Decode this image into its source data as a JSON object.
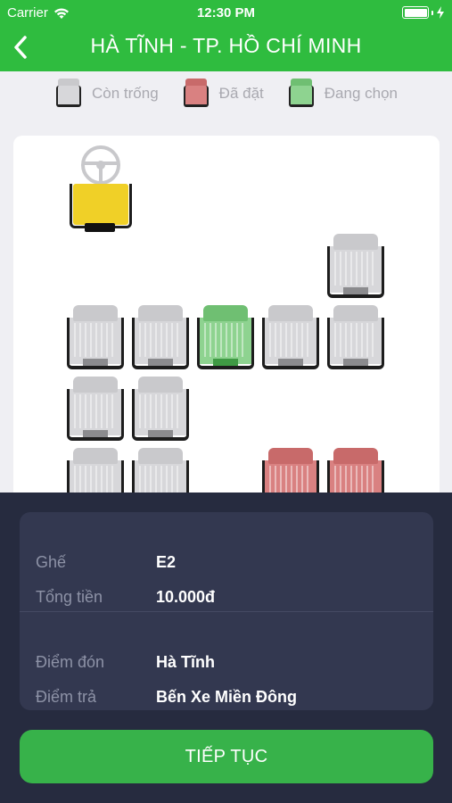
{
  "status_bar": {
    "carrier": "Carrier",
    "time": "12:30 PM"
  },
  "nav": {
    "title": "HÀ TĨNH - TP. HỒ CHÍ MINH",
    "back_icon": "chevron-left-icon"
  },
  "legend": {
    "available": "Còn trống",
    "booked": "Đã đặt",
    "selected": "Đang chọn"
  },
  "colors": {
    "brand_green": "#2fbc3f",
    "available": "#d7d7da",
    "booked": "#d98181",
    "selected": "#8ed390",
    "driver": "#f0d027",
    "sheet_bg": "#262b3f"
  },
  "seats": [
    {
      "state": "empty"
    },
    {
      "state": "empty"
    },
    {
      "state": "empty"
    },
    {
      "state": "selected"
    },
    {
      "state": "empty"
    },
    {
      "state": "empty"
    },
    {
      "state": "empty"
    },
    {
      "state": "empty"
    },
    {
      "state": "empty"
    },
    {
      "state": "empty"
    },
    {
      "state": "booked"
    },
    {
      "state": "booked"
    }
  ],
  "summary": {
    "seat_label": "Ghế",
    "seat_value": "E2",
    "total_label": "Tổng tiền",
    "total_value": "10.000đ",
    "pickup_label": "Điểm đón",
    "pickup_value": "Hà Tĩnh",
    "dropoff_label": "Điểm trả",
    "dropoff_value": "Bến Xe Miền Đông"
  },
  "cta": {
    "label": "TIẾP TỤC"
  }
}
